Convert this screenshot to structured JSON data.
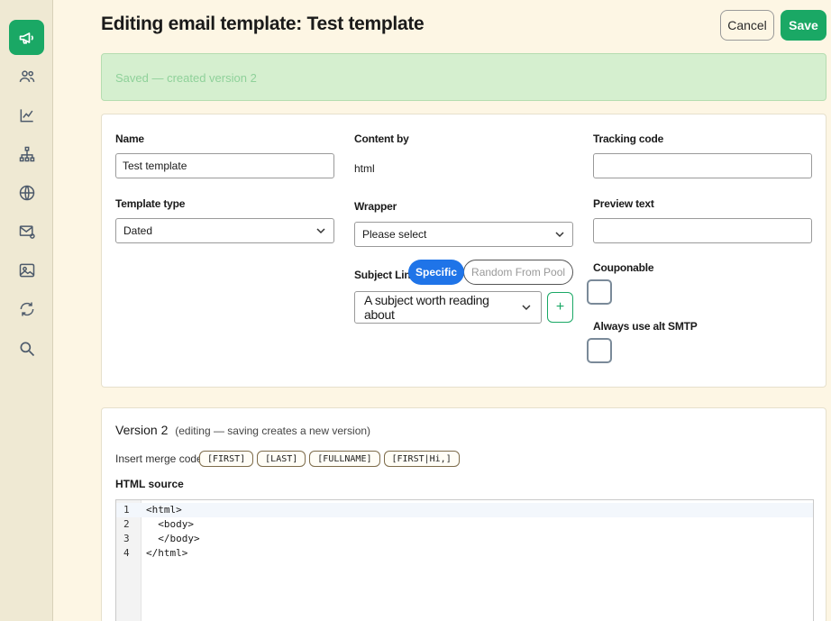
{
  "sidebar": {
    "items": [
      {
        "icon": "megaphone-icon",
        "active": true
      },
      {
        "icon": "users-icon"
      },
      {
        "icon": "chart-line-icon"
      },
      {
        "icon": "sitemap-icon"
      },
      {
        "icon": "globe-icon"
      },
      {
        "icon": "mail-at-icon"
      },
      {
        "icon": "image-icon"
      },
      {
        "icon": "refresh-icon"
      },
      {
        "icon": "search-icon"
      }
    ]
  },
  "header": {
    "title": "Editing email template: Test template",
    "cancel_label": "Cancel",
    "save_label": "Save"
  },
  "alert": {
    "message": "Saved — created version 2"
  },
  "form": {
    "name": {
      "label": "Name",
      "value": "Test template"
    },
    "template_type": {
      "label": "Template type",
      "value": "Dated"
    },
    "content_by": {
      "label": "Content by",
      "value": "html"
    },
    "wrapper": {
      "label": "Wrapper",
      "value": "Please select"
    },
    "subject_line": {
      "label": "Subject Line",
      "mode_specific": "Specific",
      "mode_pool": "Random From Pool",
      "value": "A subject worth reading about",
      "add_symbol": "+"
    },
    "tracking_code": {
      "label": "Tracking code",
      "value": ""
    },
    "preview_text": {
      "label": "Preview text",
      "value": ""
    },
    "couponable": {
      "label": "Couponable",
      "checked": false
    },
    "always_alt_smtp": {
      "label": "Always use alt SMTP",
      "checked": false
    }
  },
  "version": {
    "title": "Version 2",
    "note": "(editing — saving creates a new version)",
    "merge_label": "Insert merge code:",
    "merge_codes": [
      "[FIRST]",
      "[LAST]",
      "[FULLNAME]",
      "[FIRST|Hi,]"
    ],
    "source_label": "HTML source",
    "lines": [
      {
        "n": "1",
        "code": "<html>"
      },
      {
        "n": "2",
        "code": "  <body>"
      },
      {
        "n": "3",
        "code": "  </body>"
      },
      {
        "n": "4",
        "code": "</html>"
      }
    ]
  },
  "colors": {
    "accent": "#1aa865",
    "segment_active": "#1f74e8",
    "background": "#fdf6e4"
  }
}
